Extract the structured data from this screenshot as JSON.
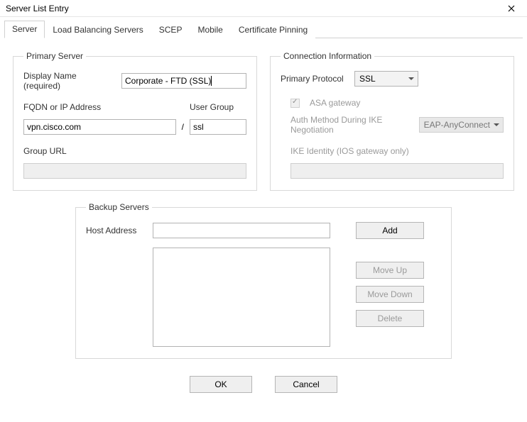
{
  "window": {
    "title": "Server List Entry"
  },
  "tabs": [
    {
      "label": "Server",
      "active": true
    },
    {
      "label": "Load Balancing Servers",
      "active": false
    },
    {
      "label": "SCEP",
      "active": false
    },
    {
      "label": "Mobile",
      "active": false
    },
    {
      "label": "Certificate Pinning",
      "active": false
    }
  ],
  "primaryServer": {
    "legend": "Primary Server",
    "displayNameLabel": "Display Name (required)",
    "displayNameValue": "Corporate - FTD (SSL)",
    "fqdnLabel": "FQDN or IP Address",
    "fqdnValue": "vpn.cisco.com",
    "slash": "/",
    "userGroupLabel": "User Group",
    "userGroupValue": "ssl",
    "groupUrlLabel": "Group URL",
    "groupUrlValue": ""
  },
  "connectionInfo": {
    "legend": "Connection Information",
    "primaryProtocolLabel": "Primary Protocol",
    "primaryProtocolValue": "SSL",
    "asaGatewayLabel": "ASA gateway",
    "asaGatewayChecked": true,
    "authMethodLabel": "Auth Method During IKE Negotiation",
    "authMethodValue": "EAP-AnyConnect",
    "ikeIdentityLabel": "IKE Identity (IOS gateway only)",
    "ikeIdentityValue": ""
  },
  "backupServers": {
    "legend": "Backup Servers",
    "hostAddressLabel": "Host Address",
    "hostAddressValue": "",
    "buttons": {
      "add": "Add",
      "moveUp": "Move Up",
      "moveDown": "Move Down",
      "delete": "Delete"
    }
  },
  "footer": {
    "ok": "OK",
    "cancel": "Cancel"
  }
}
